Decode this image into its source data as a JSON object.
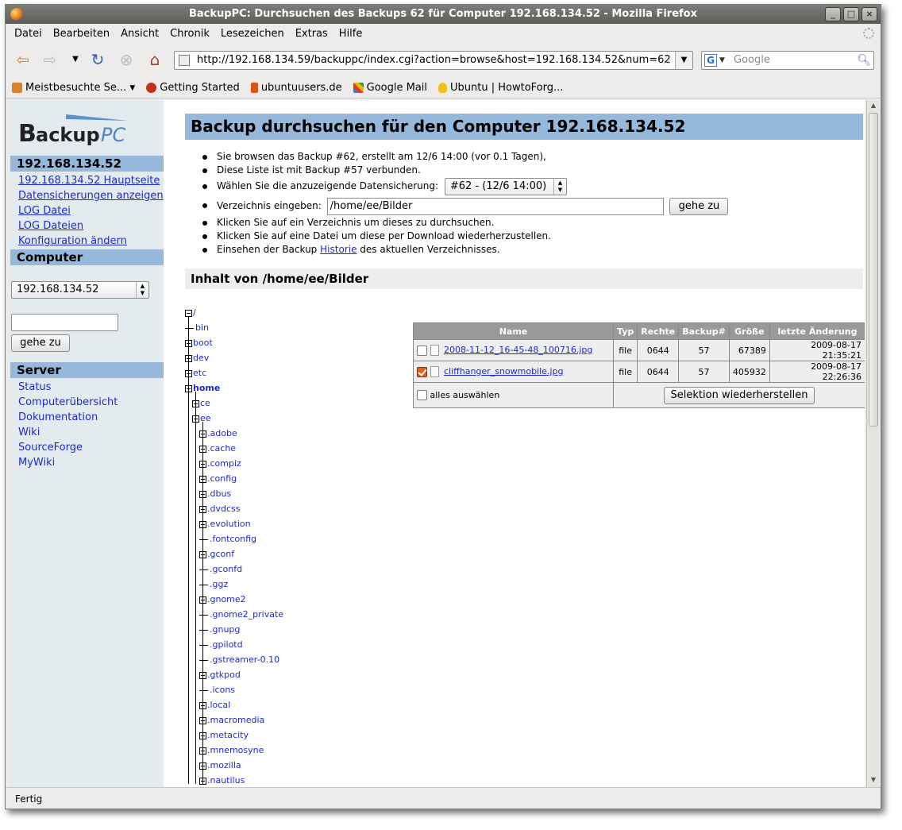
{
  "window": {
    "title": "BackupPC: Durchsuchen des Backups 62 für Computer 192.168.134.52 - Mozilla Firefox",
    "controls": {
      "minimize": "_",
      "maximize": "□",
      "close": "×"
    }
  },
  "menu": [
    "Datei",
    "Bearbeiten",
    "Ansicht",
    "Chronik",
    "Lesezeichen",
    "Extras",
    "Hilfe"
  ],
  "toolbar": {
    "url": "http://192.168.134.59/backuppc/index.cgi?action=browse&host=192.168.134.52&num=62",
    "search_placeholder": "Google",
    "icons": [
      "back-arrow-icon",
      "forward-arrow-icon",
      "reload-icon",
      "stop-icon",
      "home-icon"
    ]
  },
  "bookmarks": [
    {
      "label": "Meistbesuchte Se...",
      "color": "#d9842c"
    },
    {
      "label": "Getting Started",
      "color": "#c0321c"
    },
    {
      "label": "ubuntuusers.de",
      "color": "#d9541b"
    },
    {
      "label": "Google Mail",
      "color": "#3d7bd6"
    },
    {
      "label": "Ubuntu | HowtoForg...",
      "color": "#f2c21a"
    }
  ],
  "sidebar": {
    "host_heading": "192.168.134.52",
    "host_links": [
      "192.168.134.52 Hauptseite",
      "Datensicherungen anzeigen",
      "LOG Datei",
      "LOG Dateien",
      "Konfiguration ändern"
    ],
    "computer_heading": "Computer",
    "host_select_value": "192.168.134.52",
    "go_button": "gehe zu",
    "server_heading": "Server",
    "server_links": [
      "Status",
      "Computerübersicht",
      "Dokumentation",
      "Wiki",
      "SourceForge",
      "MyWiki"
    ]
  },
  "main": {
    "title": "Backup durchsuchen für den Computer 192.168.134.52",
    "info1": "Sie browsen das Backup #62, erstellt am 12/6 14:00 (vor 0.1 Tagen),",
    "info2": "Diese Liste ist mit Backup #57 verbunden.",
    "select_label": "Wählen Sie die anzuzeigende Datensicherung:",
    "select_value": "#62 - (12/6 14:00)",
    "dir_label": "Verzeichnis eingeben:",
    "dir_value": "/home/ee/Bilder",
    "dir_button": "gehe zu",
    "info3": "Klicken Sie auf ein Verzeichnis um dieses zu durchsuchen.",
    "info4": "Klicken Sie auf eine Datei um diese per Download wiederherzustellen.",
    "history_prefix": "Einsehen der Backup",
    "history_link": "Historie",
    "history_suffix": "des aktuellen Verzeichnisses.",
    "contents_heading": "Inhalt von /home/ee/Bilder"
  },
  "tree": {
    "root": "/",
    "level1": [
      {
        "name": "bin",
        "exp": "none"
      },
      {
        "name": "boot",
        "exp": "plus"
      },
      {
        "name": "dev",
        "exp": "plus"
      },
      {
        "name": "etc",
        "exp": "plus"
      },
      {
        "name": "home",
        "exp": "minus"
      }
    ],
    "home_children": [
      {
        "name": "ce",
        "exp": "plus"
      },
      {
        "name": "ee",
        "exp": "minus"
      }
    ],
    "ee_children": [
      {
        "name": ".adobe",
        "exp": "plus"
      },
      {
        "name": ".cache",
        "exp": "plus"
      },
      {
        "name": ".compiz",
        "exp": "plus"
      },
      {
        "name": ".config",
        "exp": "plus"
      },
      {
        "name": ".dbus",
        "exp": "plus"
      },
      {
        "name": ".dvdcss",
        "exp": "plus"
      },
      {
        "name": ".evolution",
        "exp": "plus"
      },
      {
        "name": ".fontconfig",
        "exp": "none"
      },
      {
        "name": ".gconf",
        "exp": "plus"
      },
      {
        "name": ".gconfd",
        "exp": "none"
      },
      {
        "name": ".ggz",
        "exp": "none"
      },
      {
        "name": ".gnome2",
        "exp": "plus"
      },
      {
        "name": ".gnome2_private",
        "exp": "none"
      },
      {
        "name": ".gnupg",
        "exp": "none"
      },
      {
        "name": ".gpilotd",
        "exp": "none"
      },
      {
        "name": ".gstreamer-0.10",
        "exp": "none"
      },
      {
        "name": ".gtkpod",
        "exp": "plus"
      },
      {
        "name": ".icons",
        "exp": "none"
      },
      {
        "name": ".local",
        "exp": "plus"
      },
      {
        "name": ".macromedia",
        "exp": "plus"
      },
      {
        "name": ".metacity",
        "exp": "plus"
      },
      {
        "name": ".mnemosyne",
        "exp": "plus"
      },
      {
        "name": ".mozilla",
        "exp": "plus"
      },
      {
        "name": ".nautilus",
        "exp": "plus"
      }
    ]
  },
  "files": {
    "headers": [
      "Name",
      "Typ",
      "Rechte",
      "Backup#",
      "Größe",
      "letzte Änderung"
    ],
    "rows": [
      {
        "name": "2008-11-12_16-45-48_100716.jpg",
        "typ": "file",
        "rechte": "0644",
        "backup": "57",
        "size": "67389",
        "mtime": "2009-08-17 21:35:21",
        "checked": false
      },
      {
        "name": "cliffhanger_snowmobile.jpg",
        "typ": "file",
        "rechte": "0644",
        "backup": "57",
        "size": "405932",
        "mtime": "2009-08-17 22:26:36",
        "checked": true
      }
    ],
    "select_all": "alles auswählen",
    "restore_button": "Selektion wiederherstellen"
  },
  "status": "Fertig"
}
